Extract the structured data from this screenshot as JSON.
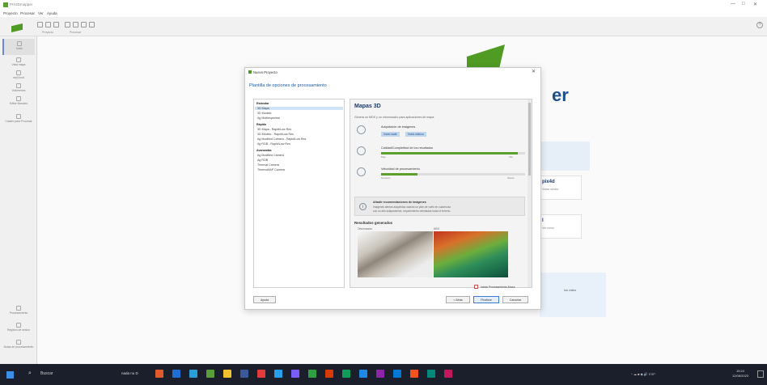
{
  "window": {
    "title": "PIX4Dmapper",
    "controls": [
      "—",
      "□",
      "✕"
    ]
  },
  "menu": [
    "Proyecto",
    "Procesar",
    "Ver",
    "Ayuda"
  ],
  "toolbar": {
    "groups": [
      "Proyecto",
      "Procesar"
    ],
    "help_label": "?"
  },
  "sidebar": {
    "items": [
      {
        "label": "Inicio",
        "icon": "home-icon"
      },
      {
        "label": "Vista mapa",
        "icon": "map-icon"
      },
      {
        "label": "rayCloud",
        "icon": "raycloud-icon"
      },
      {
        "label": "Volúmenes",
        "icon": "volume-icon"
      },
      {
        "label": "Editor Mosaico",
        "icon": "mosaic-icon"
      },
      {
        "label": "Cuadro para Procesar",
        "icon": "index-icon"
      }
    ],
    "bottom_items": [
      {
        "label": "Procesamiento",
        "icon": "processing-icon"
      },
      {
        "label": "Registro de sesión",
        "icon": "log-icon"
      },
      {
        "label": "Notas de procesamiento",
        "icon": "notes-icon"
      }
    ]
  },
  "background": {
    "brand_text": "er",
    "cards": [
      {
        "title": "pix4d",
        "sub": "Iniciar sesión"
      },
      {
        "title": "l",
        "sub": "Ver curso"
      }
    ],
    "help_link": "los vídeo"
  },
  "dialog": {
    "title": "Nuevo Proyecto",
    "close": "✕",
    "heading": "Plantilla de opciones de procesamiento",
    "list": [
      {
        "text": "Estándar",
        "type": "header"
      },
      {
        "text": "3D Mapa",
        "type": "selected"
      },
      {
        "text": "3D Modelo",
        "type": "item"
      },
      {
        "text": "Ag Multiespectral",
        "type": "item"
      },
      {
        "text": "Rápido",
        "type": "header"
      },
      {
        "text": "3D Mapa - Rapid/Low Res",
        "type": "item"
      },
      {
        "text": "3D Modelo - Rapid/Low Res",
        "type": "item"
      },
      {
        "text": "Ag Modified Camera - Rapid/Low Res",
        "type": "item"
      },
      {
        "text": "Ag RGB - Rapid/Low Res",
        "type": "item"
      },
      {
        "text": "Avanzadas",
        "type": "header"
      },
      {
        "text": "Ag Modified Camera",
        "type": "item"
      },
      {
        "text": "Ag RGB",
        "type": "item"
      },
      {
        "text": "Thermal Camera",
        "type": "item"
      },
      {
        "text": "ThermoMAP Camera",
        "type": "item"
      }
    ],
    "detail": {
      "title": "Mapas 3D",
      "description": "Genera un MDS y un ortomosaico para aplicaciones de mapa.",
      "acquisition": {
        "label": "Adquisición de imágenes",
        "tags": [
          "Vuelo nadir",
          "Vuelo oblicuo"
        ]
      },
      "quality": {
        "label": "Calidad/Completitud de los resultados",
        "level": 0.95,
        "low": "Baja",
        "high": "Alta"
      },
      "speed": {
        "label": "Velocidad de procesamiento",
        "level": 0.25,
        "low": "Despacio",
        "high": "Rápido"
      },
      "recommendations": {
        "title": "Añadir recomendaciones de imágenes",
        "line1": "Imágenes aéreas adquiridas usando un plan de vuelo en cuadrícula",
        "line2": "con un alto solapamiento, requerimiento orientadas hacia el terreno."
      },
      "results": {
        "title": "Resultados generados",
        "items": [
          "Ortomosaico",
          "MDS"
        ]
      }
    },
    "checkbox_label": "Iniciar Procesamiento Ahora",
    "buttons": {
      "help": "Ayuda",
      "back": "< Atrás",
      "finish": "Finalizar",
      "cancel": "Cancelar"
    }
  },
  "taskbar": {
    "search_placeholder": "Buscar",
    "hint": "nada nu D",
    "apps": [
      "#e05a2b",
      "#1d6fd6",
      "#2a9fd6",
      "#5a9e3a",
      "#f2c12e",
      "#3b5998",
      "#e23b3b",
      "#24a0ed",
      "#7a5cff",
      "#2ea043",
      "#d83b01",
      "#0f9d58",
      "#1e88e5",
      "#8e24aa",
      "#0078d4",
      "#f4511e",
      "#00897b",
      "#c2185b"
    ],
    "tray": "^ ☁ ■ ◆ 🔊 ESP",
    "clock_time": "15:24",
    "clock_date": "12/08/2023"
  }
}
